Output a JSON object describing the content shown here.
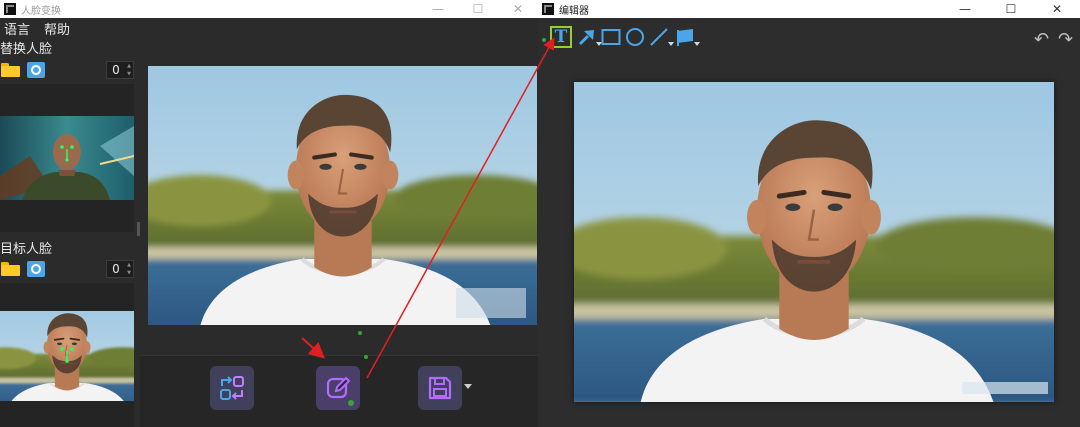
{
  "left_window": {
    "title": "人脸变换",
    "controls": {
      "minimize": "—",
      "maximize": "☐",
      "close": "✕"
    },
    "menu": [
      {
        "label": "语言"
      },
      {
        "label": "帮助"
      }
    ],
    "source_section": {
      "label": "替换人脸",
      "count": "0"
    },
    "target_section": {
      "label": "目标人脸",
      "count": "0"
    },
    "actions": [
      {
        "name": "swap-face-button",
        "icon": "swap-arrows-icon"
      },
      {
        "name": "edit-button",
        "icon": "edit-pencil-icon"
      },
      {
        "name": "save-button",
        "icon": "floppy-disk-icon",
        "has_dropdown": true
      }
    ]
  },
  "right_window": {
    "title": "编辑器",
    "controls": {
      "minimize": "—",
      "maximize": "☐",
      "close": "✕"
    },
    "tools": [
      {
        "name": "text-tool",
        "label": "T",
        "icon": "text-icon",
        "active": true
      },
      {
        "name": "arrow-tool",
        "icon": "arrow-icon",
        "has_dropdown": true
      },
      {
        "name": "rectangle-tool",
        "icon": "rectangle-icon"
      },
      {
        "name": "ellipse-tool",
        "icon": "ellipse-icon"
      },
      {
        "name": "line-tool",
        "icon": "line-icon",
        "has_dropdown": true
      },
      {
        "name": "color-tool",
        "icon": "flag-icon",
        "has_dropdown": true
      }
    ],
    "history": {
      "undo": "↶",
      "redo": "↷"
    }
  },
  "colors": {
    "window_bg": "#2b2b2b",
    "accent_blue": "#4aa6e8",
    "accent_purple": "#b36bff",
    "active_tool_border": "#9acd32",
    "annotation_red": "#e02020"
  }
}
